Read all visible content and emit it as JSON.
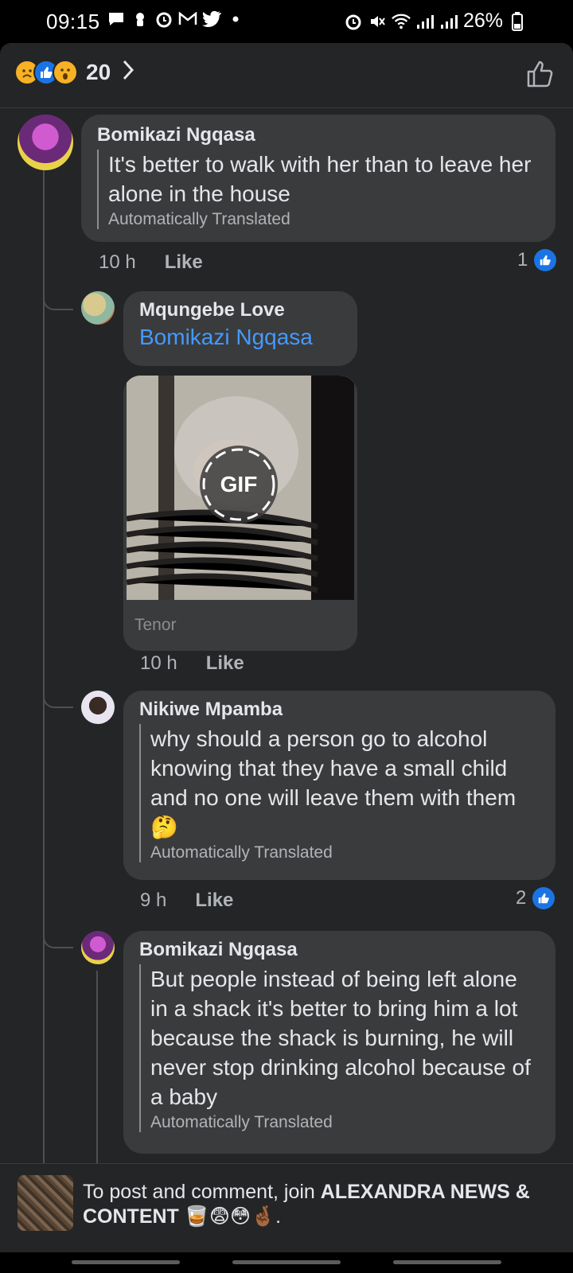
{
  "status_bar": {
    "time": "09:15",
    "battery": "26%"
  },
  "reactions": {
    "count": "20",
    "icons": [
      "sad-reaction",
      "like-reaction",
      "wow-reaction"
    ]
  },
  "comments": [
    {
      "author": "Bomikazi Ngqasa",
      "text": "It's better to walk with her than to leave her alone in the house",
      "translated_label": "Automatically Translated",
      "time": "10 h",
      "like_label": "Like",
      "like_count": "1"
    },
    {
      "author": "Mqungebe Love",
      "mention": "Bomikazi Ngqasa",
      "gif_label": "GIF",
      "gif_source": "Tenor",
      "time": "10 h",
      "like_label": "Like"
    },
    {
      "author": "Nikiwe Mpamba",
      "text": "why should a person go to alcohol knowing that they have a small child and no one will leave them with them 🤔",
      "translated_label": "Automatically Translated",
      "time": "9 h",
      "like_label": "Like",
      "like_count": "2"
    },
    {
      "author": "Bomikazi Ngqasa",
      "text": "But people instead of being left alone in a shack it's better to bring him a lot because the shack is burning, he will never stop drinking alcohol because of a baby",
      "translated_label": "Automatically Translated"
    }
  ],
  "join_bar": {
    "prefix": "To post and comment, join ",
    "group_name": "ALEXANDRA NEWS & CONTENT 🥃😨😳🤞🏾",
    "suffix": "."
  },
  "colors": {
    "background": "#242526",
    "bubble": "#3a3b3c",
    "accent_blue": "#1b74e4",
    "mention_blue": "#4599ff"
  }
}
